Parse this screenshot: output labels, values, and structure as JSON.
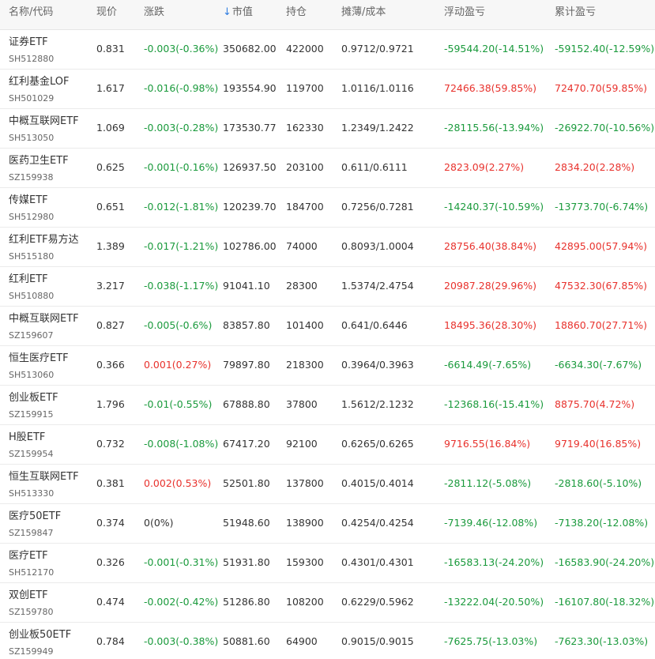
{
  "header": {
    "name_code": "名称/代码",
    "price": "现价",
    "change": "涨跌",
    "sort_icon": "arrow-down-icon",
    "market_value": "市值",
    "position": "持仓",
    "cost": "摊薄/成本",
    "floating_pnl": "浮动盈亏",
    "total_pnl": "累计盈亏"
  },
  "colors": {
    "gain": "#e8322d",
    "loss": "#1a9a3c",
    "sort_accent": "#2f7de1"
  },
  "rows": [
    {
      "name": "证券ETF",
      "code": "SH512880",
      "price": "0.831",
      "change": "-0.003(-0.36%)",
      "change_dir": "down",
      "market_value": "350682.00",
      "position": "422000",
      "cost": "0.9712/0.9721",
      "floating_pnl": "-59544.20(-14.51%)",
      "floating_dir": "down",
      "total_pnl": "-59152.40(-12.59%)",
      "total_dir": "down"
    },
    {
      "name": "红利基金LOF",
      "code": "SH501029",
      "price": "1.617",
      "change": "-0.016(-0.98%)",
      "change_dir": "down",
      "market_value": "193554.90",
      "position": "119700",
      "cost": "1.0116/1.0116",
      "floating_pnl": "72466.38(59.85%)",
      "floating_dir": "up",
      "total_pnl": "72470.70(59.85%)",
      "total_dir": "up"
    },
    {
      "name": "中概互联网ETF",
      "code": "SH513050",
      "price": "1.069",
      "change": "-0.003(-0.28%)",
      "change_dir": "down",
      "market_value": "173530.77",
      "position": "162330",
      "cost": "1.2349/1.2422",
      "floating_pnl": "-28115.56(-13.94%)",
      "floating_dir": "down",
      "total_pnl": "-26922.70(-10.56%)",
      "total_dir": "down"
    },
    {
      "name": "医药卫生ETF",
      "code": "SZ159938",
      "price": "0.625",
      "change": "-0.001(-0.16%)",
      "change_dir": "down",
      "market_value": "126937.50",
      "position": "203100",
      "cost": "0.611/0.6111",
      "floating_pnl": "2823.09(2.27%)",
      "floating_dir": "up",
      "total_pnl": "2834.20(2.28%)",
      "total_dir": "up"
    },
    {
      "name": "传媒ETF",
      "code": "SH512980",
      "price": "0.651",
      "change": "-0.012(-1.81%)",
      "change_dir": "down",
      "market_value": "120239.70",
      "position": "184700",
      "cost": "0.7256/0.7281",
      "floating_pnl": "-14240.37(-10.59%)",
      "floating_dir": "down",
      "total_pnl": "-13773.70(-6.74%)",
      "total_dir": "down"
    },
    {
      "name": "红利ETF易方达",
      "code": "SH515180",
      "price": "1.389",
      "change": "-0.017(-1.21%)",
      "change_dir": "down",
      "market_value": "102786.00",
      "position": "74000",
      "cost": "0.8093/1.0004",
      "floating_pnl": "28756.40(38.84%)",
      "floating_dir": "up",
      "total_pnl": "42895.00(57.94%)",
      "total_dir": "up"
    },
    {
      "name": "红利ETF",
      "code": "SH510880",
      "price": "3.217",
      "change": "-0.038(-1.17%)",
      "change_dir": "down",
      "market_value": "91041.10",
      "position": "28300",
      "cost": "1.5374/2.4754",
      "floating_pnl": "20987.28(29.96%)",
      "floating_dir": "up",
      "total_pnl": "47532.30(67.85%)",
      "total_dir": "up"
    },
    {
      "name": "中概互联网ETF",
      "code": "SZ159607",
      "price": "0.827",
      "change": "-0.005(-0.6%)",
      "change_dir": "down",
      "market_value": "83857.80",
      "position": "101400",
      "cost": "0.641/0.6446",
      "floating_pnl": "18495.36(28.30%)",
      "floating_dir": "up",
      "total_pnl": "18860.70(27.71%)",
      "total_dir": "up"
    },
    {
      "name": "恒生医疗ETF",
      "code": "SH513060",
      "price": "0.366",
      "change": "0.001(0.27%)",
      "change_dir": "up",
      "market_value": "79897.80",
      "position": "218300",
      "cost": "0.3964/0.3963",
      "floating_pnl": "-6614.49(-7.65%)",
      "floating_dir": "down",
      "total_pnl": "-6634.30(-7.67%)",
      "total_dir": "down"
    },
    {
      "name": "创业板ETF",
      "code": "SZ159915",
      "price": "1.796",
      "change": "-0.01(-0.55%)",
      "change_dir": "down",
      "market_value": "67888.80",
      "position": "37800",
      "cost": "1.5612/2.1232",
      "floating_pnl": "-12368.16(-15.41%)",
      "floating_dir": "down",
      "total_pnl": "8875.70(4.72%)",
      "total_dir": "up"
    },
    {
      "name": "H股ETF",
      "code": "SZ159954",
      "price": "0.732",
      "change": "-0.008(-1.08%)",
      "change_dir": "down",
      "market_value": "67417.20",
      "position": "92100",
      "cost": "0.6265/0.6265",
      "floating_pnl": "9716.55(16.84%)",
      "floating_dir": "up",
      "total_pnl": "9719.40(16.85%)",
      "total_dir": "up"
    },
    {
      "name": "恒生互联网ETF",
      "code": "SH513330",
      "price": "0.381",
      "change": "0.002(0.53%)",
      "change_dir": "up",
      "market_value": "52501.80",
      "position": "137800",
      "cost": "0.4015/0.4014",
      "floating_pnl": "-2811.12(-5.08%)",
      "floating_dir": "down",
      "total_pnl": "-2818.60(-5.10%)",
      "total_dir": "down"
    },
    {
      "name": "医疗50ETF",
      "code": "SZ159847",
      "price": "0.374",
      "change": "0(0%)",
      "change_dir": "flat",
      "market_value": "51948.60",
      "position": "138900",
      "cost": "0.4254/0.4254",
      "floating_pnl": "-7139.46(-12.08%)",
      "floating_dir": "down",
      "total_pnl": "-7138.20(-12.08%)",
      "total_dir": "down"
    },
    {
      "name": "医疗ETF",
      "code": "SH512170",
      "price": "0.326",
      "change": "-0.001(-0.31%)",
      "change_dir": "down",
      "market_value": "51931.80",
      "position": "159300",
      "cost": "0.4301/0.4301",
      "floating_pnl": "-16583.13(-24.20%)",
      "floating_dir": "down",
      "total_pnl": "-16583.90(-24.20%)",
      "total_dir": "down"
    },
    {
      "name": "双创ETF",
      "code": "SZ159780",
      "price": "0.474",
      "change": "-0.002(-0.42%)",
      "change_dir": "down",
      "market_value": "51286.80",
      "position": "108200",
      "cost": "0.6229/0.5962",
      "floating_pnl": "-13222.04(-20.50%)",
      "floating_dir": "down",
      "total_pnl": "-16107.80(-18.32%)",
      "total_dir": "down"
    },
    {
      "name": "创业板50ETF",
      "code": "SZ159949",
      "price": "0.784",
      "change": "-0.003(-0.38%)",
      "change_dir": "down",
      "market_value": "50881.60",
      "position": "64900",
      "cost": "0.9015/0.9015",
      "floating_pnl": "-7625.75(-13.03%)",
      "floating_dir": "down",
      "total_pnl": "-7623.30(-13.03%)",
      "total_dir": "down"
    }
  ]
}
